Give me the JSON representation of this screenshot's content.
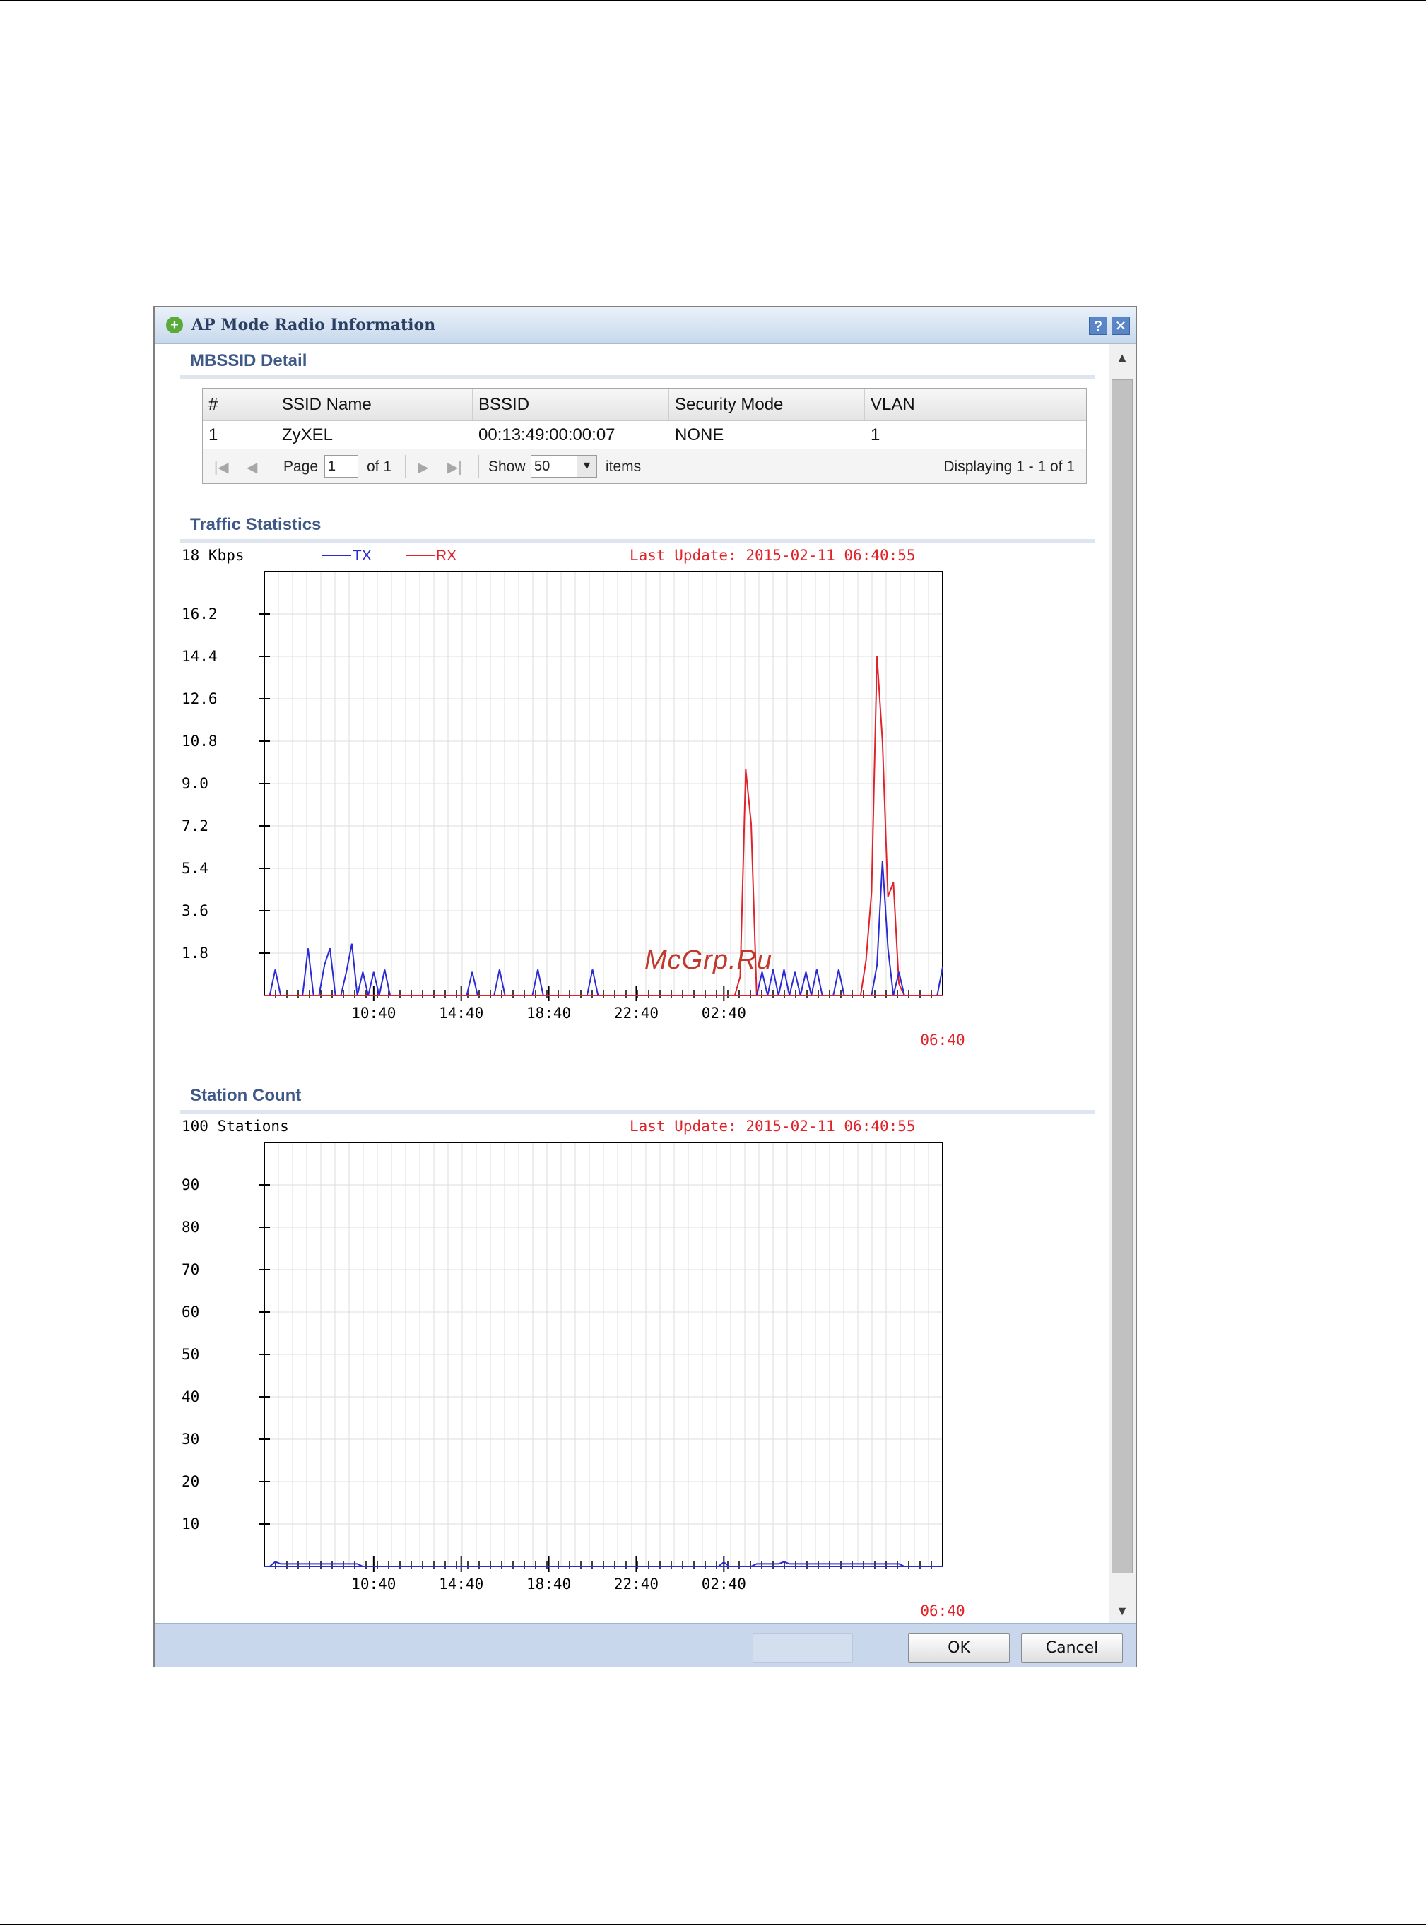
{
  "watermark": "McGrp.Ru",
  "window": {
    "title": "AP Mode Radio Information",
    "help_icon": "?",
    "close_icon": "✕"
  },
  "mbssid": {
    "section_title": "MBSSID Detail",
    "columns": [
      "#",
      "SSID Name",
      "BSSID",
      "Security Mode",
      "VLAN"
    ],
    "rows": [
      [
        "1",
        "ZyXEL",
        "00:13:49:00:00:07",
        "NONE",
        "1"
      ]
    ],
    "pager": {
      "page_label": "Page",
      "page_value": "1",
      "of_label": "of 1",
      "show_label": "Show",
      "show_value": "50",
      "items_label": "items",
      "displaying": "Displaying 1 - 1 of 1"
    }
  },
  "traffic": {
    "section_title": "Traffic Statistics",
    "unit_label": "18 Kbps",
    "legend_tx": "TX",
    "legend_rx": "RX",
    "last_update": "Last Update: 2015-02-11 06:40:55",
    "colors": {
      "tx": "#2b2bd6",
      "rx": "#e0232b",
      "label_red": "#e0232b"
    }
  },
  "station": {
    "section_title": "Station Count",
    "unit_label": "100 Stations",
    "last_update": "Last Update: 2015-02-11 06:40:55"
  },
  "chart_data": [
    {
      "type": "line",
      "title": "Traffic Statistics",
      "ylabel": "18 Kbps",
      "ylim": [
        0,
        18
      ],
      "yticks": [
        "1.8",
        "3.6",
        "5.4",
        "7.2",
        "9.0",
        "10.8",
        "12.6",
        "14.4",
        "16.2"
      ],
      "xticks": [
        "10:40",
        "14:40",
        "18:40",
        "22:40",
        "02:40"
      ],
      "x_end_label": "06:40",
      "grid": true,
      "legend_position": "top-left",
      "series": [
        {
          "name": "TX",
          "color": "#2b2bd6",
          "points": [
            [
              1,
              0
            ],
            [
              2,
              1.1
            ],
            [
              3,
              0
            ],
            [
              7,
              0
            ],
            [
              8,
              2.0
            ],
            [
              9,
              0
            ],
            [
              10,
              0
            ],
            [
              11,
              1.3
            ],
            [
              12,
              2.0
            ],
            [
              13,
              0
            ],
            [
              14,
              0
            ],
            [
              15,
              1.0
            ],
            [
              16,
              2.2
            ],
            [
              17,
              0
            ],
            [
              18,
              1.0
            ],
            [
              19,
              0
            ],
            [
              20,
              1.0
            ],
            [
              21,
              0
            ],
            [
              22,
              1.1
            ],
            [
              23,
              0
            ],
            [
              37,
              0
            ],
            [
              38,
              1.0
            ],
            [
              39,
              0
            ],
            [
              42,
              0
            ],
            [
              43,
              1.1
            ],
            [
              44,
              0
            ],
            [
              49,
              0
            ],
            [
              50,
              1.1
            ],
            [
              51,
              0
            ],
            [
              59,
              0
            ],
            [
              60,
              1.1
            ],
            [
              61,
              0
            ],
            [
              90,
              0
            ],
            [
              91,
              1.0
            ],
            [
              92,
              0
            ],
            [
              93,
              1.1
            ],
            [
              94,
              0
            ],
            [
              95,
              1.1
            ],
            [
              96,
              0
            ],
            [
              97,
              1.0
            ],
            [
              98,
              0
            ],
            [
              99,
              1.0
            ],
            [
              100,
              0
            ],
            [
              101,
              1.1
            ],
            [
              102,
              0
            ],
            [
              104,
              0
            ],
            [
              105,
              1.1
            ],
            [
              106,
              0
            ],
            [
              111,
              0
            ],
            [
              112,
              1.3
            ],
            [
              113,
              5.7
            ],
            [
              114,
              2.0
            ],
            [
              115,
              0
            ],
            [
              116,
              1.0
            ],
            [
              117,
              0
            ],
            [
              123,
              0
            ],
            [
              124,
              1.2
            ]
          ]
        },
        {
          "name": "RX",
          "color": "#e0232b",
          "points": [
            [
              86,
              0
            ],
            [
              87,
              0.8
            ],
            [
              88,
              9.6
            ],
            [
              89,
              7.3
            ],
            [
              90,
              0
            ],
            [
              109,
              0
            ],
            [
              110,
              1.5
            ],
            [
              111,
              4.4
            ],
            [
              112,
              14.4
            ],
            [
              113,
              10.8
            ],
            [
              114,
              4.2
            ],
            [
              115,
              4.8
            ],
            [
              116,
              0.5
            ],
            [
              117,
              0
            ]
          ]
        }
      ]
    },
    {
      "type": "line",
      "title": "Station Count",
      "ylabel": "100 Stations",
      "ylim": [
        0,
        100
      ],
      "yticks": [
        "10",
        "20",
        "30",
        "40",
        "50",
        "60",
        "70",
        "80",
        "90"
      ],
      "xticks": [
        "10:40",
        "14:40",
        "18:40",
        "22:40",
        "02:40"
      ],
      "x_end_label": "06:40",
      "grid": true,
      "series": [
        {
          "name": "Stations",
          "color": "#2b2bd6",
          "points": [
            [
              0,
              0
            ],
            [
              1,
              0
            ],
            [
              2,
              1.1
            ],
            [
              3,
              0.6
            ],
            [
              4,
              0.6
            ],
            [
              17,
              0.6
            ],
            [
              18,
              0
            ],
            [
              83,
              0
            ],
            [
              84,
              1.0
            ],
            [
              85,
              0
            ],
            [
              89,
              0
            ],
            [
              90,
              0.6
            ],
            [
              94,
              0.6
            ],
            [
              95,
              1.1
            ],
            [
              96,
              0.6
            ],
            [
              116,
              0.6
            ],
            [
              117,
              0
            ]
          ]
        }
      ]
    }
  ]
}
